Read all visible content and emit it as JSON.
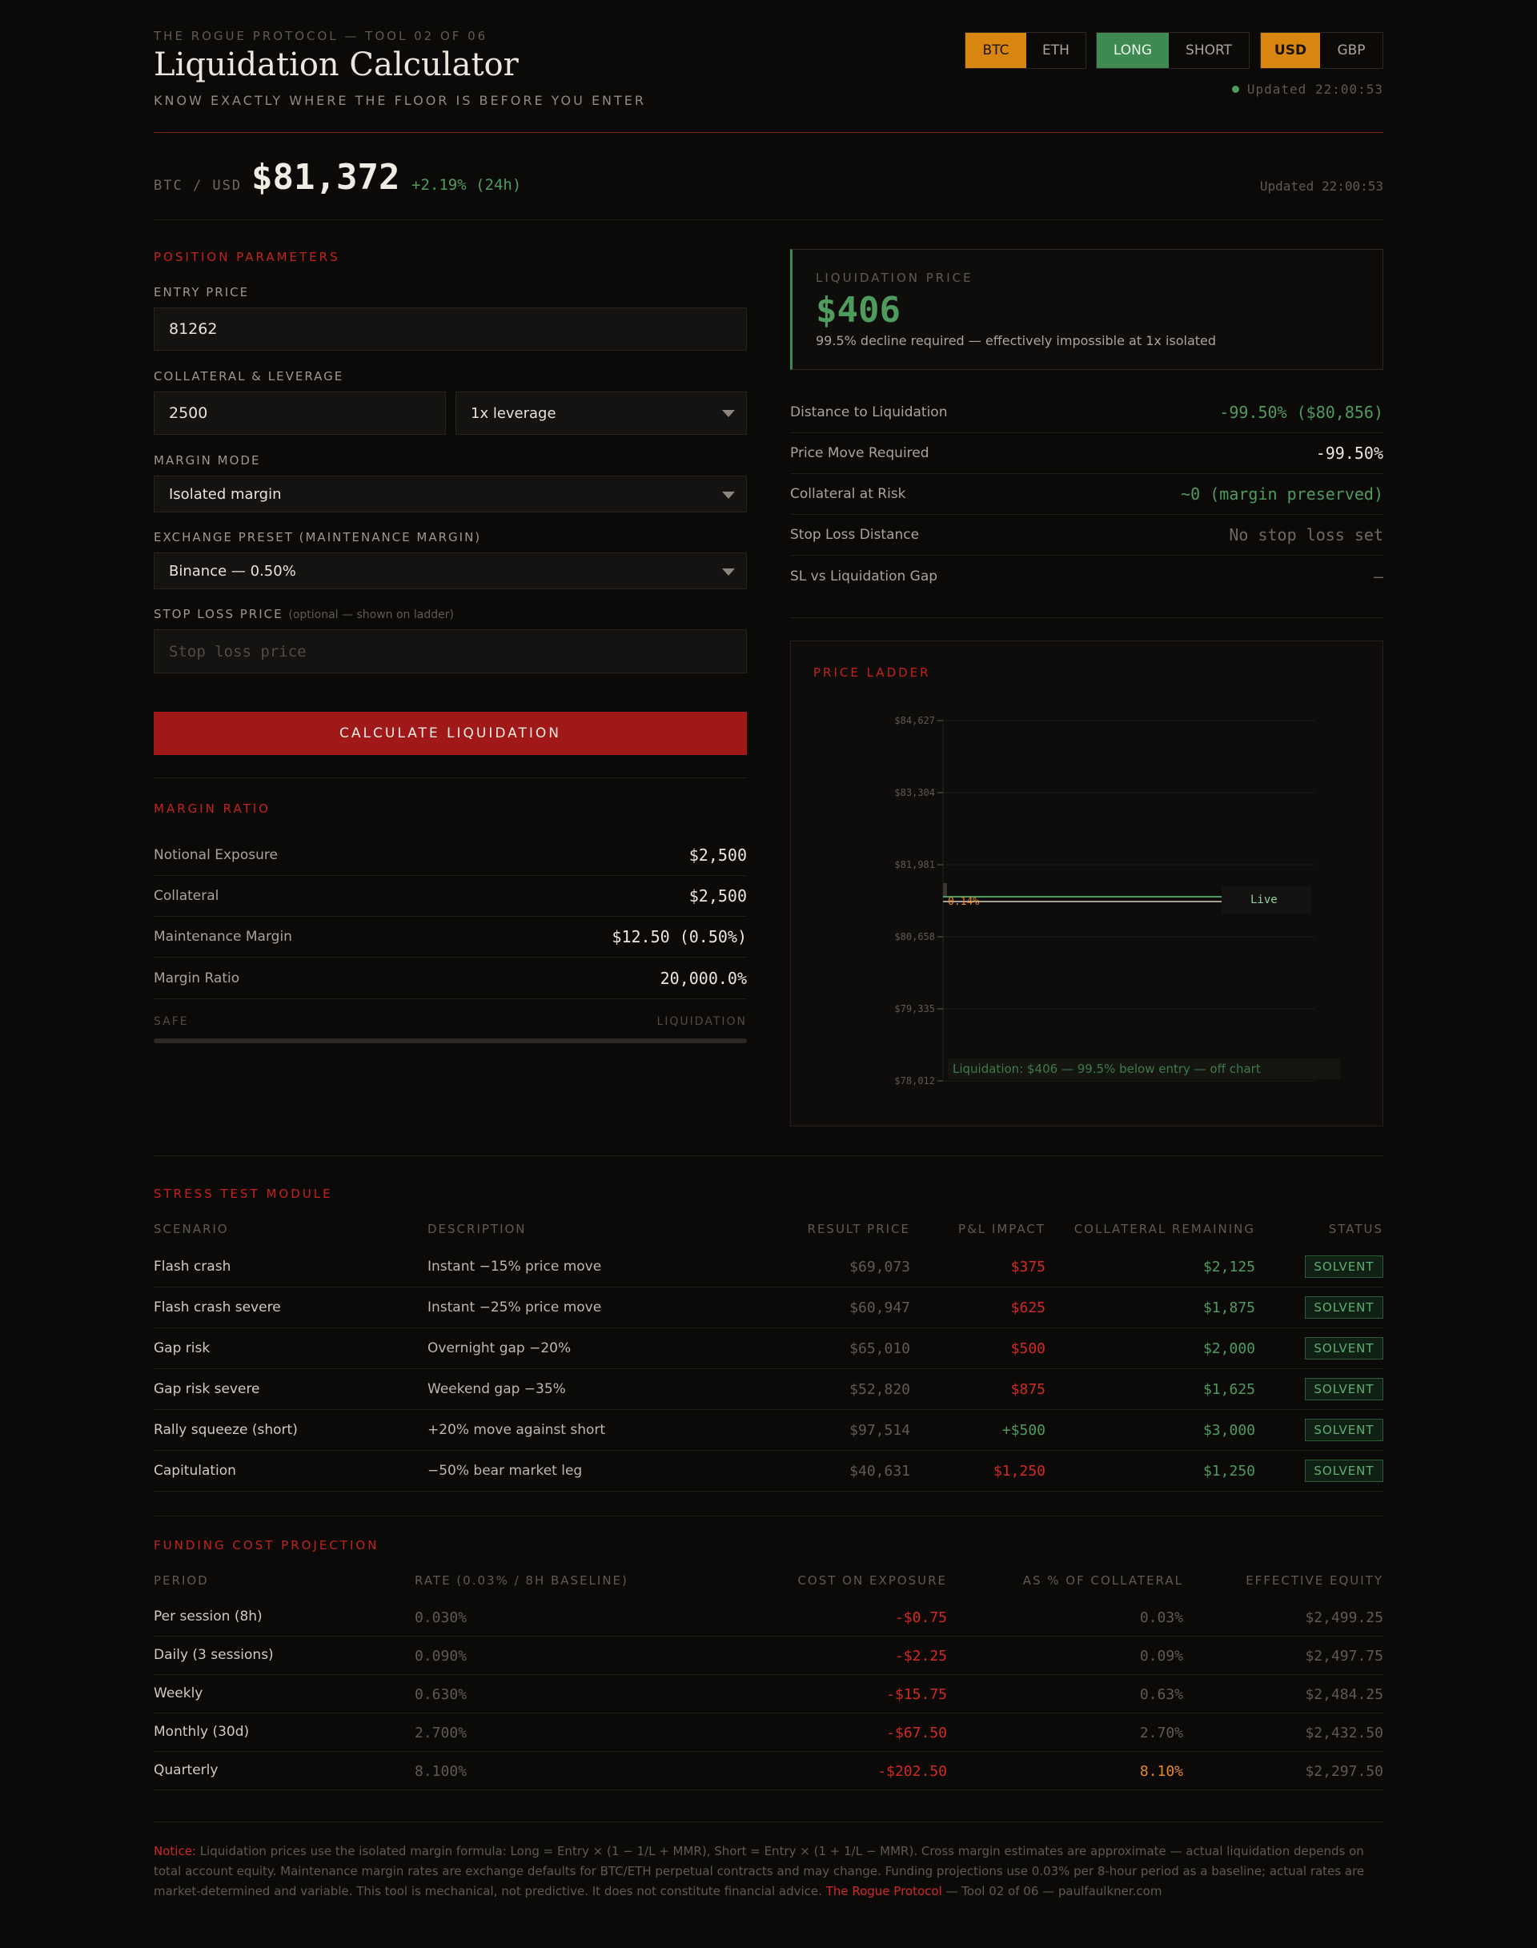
{
  "header": {
    "kicker": "THE ROGUE PROTOCOL — TOOL 02 OF 06",
    "title": "Liquidation Calculator",
    "subtitle": "KNOW EXACTLY WHERE THE FLOOR IS BEFORE YOU ENTER",
    "asset_toggle": [
      "BTC",
      "ETH"
    ],
    "direction_toggle": [
      "LONG",
      "SHORT"
    ],
    "currency_toggle": [
      "USD",
      "GBP"
    ],
    "updated": "Updated 22:00:53"
  },
  "ticker": {
    "pair": "BTC / USD",
    "price": "$81,372",
    "change": "+2.19% (24h)",
    "updated": "Updated 22:00:53"
  },
  "params": {
    "section": "POSITION PARAMETERS",
    "entry_label": "ENTRY PRICE",
    "entry_value": "81262",
    "collateral_label": "COLLATERAL & LEVERAGE",
    "collateral_value": "2500",
    "leverage_value": "1x leverage",
    "margin_mode_label": "MARGIN MODE",
    "margin_mode_value": "Isolated margin",
    "exchange_label": "EXCHANGE PRESET (MAINTENANCE MARGIN)",
    "exchange_value": "Binance — 0.50%",
    "stop_label": "STOP LOSS PRICE",
    "stop_hint": "(optional — shown on ladder)",
    "stop_placeholder": "Stop loss price",
    "calc_button": "CALCULATE LIQUIDATION"
  },
  "margin": {
    "section": "MARGIN RATIO",
    "rows": [
      {
        "k": "Notional Exposure",
        "v": "$2,500"
      },
      {
        "k": "Collateral",
        "v": "$2,500"
      },
      {
        "k": "Maintenance Margin",
        "v": "$12.50 (0.50%)"
      },
      {
        "k": "Margin Ratio",
        "v": "20,000.0%"
      }
    ],
    "scale_left": "SAFE",
    "scale_right": "LIQUIDATION",
    "level": 0
  },
  "liquidation": {
    "label": "LIQUIDATION PRICE",
    "value": "$406",
    "desc": "99.5% decline required — effectively impossible at 1x isolated",
    "rows": [
      {
        "k": "Distance to Liquidation",
        "v": "-99.50% ($80,856)"
      },
      {
        "k": "Price Move Required",
        "v": "-99.50%"
      },
      {
        "k": "Collateral at Risk",
        "v": "~0 (margin preserved)"
      },
      {
        "k": "Stop Loss Distance",
        "v": "No stop loss set"
      },
      {
        "k": "SL vs Liquidation Gap",
        "v": "—"
      }
    ]
  },
  "ladder": {
    "label": "PRICE LADDER",
    "ticks": [
      "$84,627",
      "$83,304",
      "$81,981",
      "$80,658",
      "$79,335",
      "$78,012"
    ],
    "entry_tag": "0.14%",
    "live_tag": "Live",
    "liq_note": "Liquidation: $406 — 99.5% below entry — off chart",
    "colors": {
      "entry": "#e8862a",
      "live": "#4f9a5d"
    }
  },
  "stress": {
    "section": "STRESS TEST MODULE",
    "headers": [
      "SCENARIO",
      "DESCRIPTION",
      "RESULT PRICE",
      "P&L IMPACT",
      "COLLATERAL REMAINING",
      "STATUS"
    ],
    "rows": [
      {
        "scenario": "Flash crash",
        "desc": "Instant −15% price move",
        "price": "$69,073",
        "pnl": "$375",
        "remaining": "$2,125",
        "status": "SOLVENT"
      },
      {
        "scenario": "Flash crash severe",
        "desc": "Instant −25% price move",
        "price": "$60,947",
        "pnl": "$625",
        "remaining": "$1,875",
        "status": "SOLVENT"
      },
      {
        "scenario": "Gap risk",
        "desc": "Overnight gap −20%",
        "price": "$65,010",
        "pnl": "$500",
        "remaining": "$2,000",
        "status": "SOLVENT"
      },
      {
        "scenario": "Gap risk severe",
        "desc": "Weekend gap −35%",
        "price": "$52,820",
        "pnl": "$875",
        "remaining": "$1,625",
        "status": "SOLVENT"
      },
      {
        "scenario": "Rally squeeze (short)",
        "desc": "+20% move against short",
        "price": "$97,514",
        "pnl": "+$500",
        "remaining": "$3,000",
        "status": "SOLVENT"
      },
      {
        "scenario": "Capitulation",
        "desc": "−50% bear market leg",
        "price": "$40,631",
        "pnl": "$1,250",
        "remaining": "$1,250",
        "status": "SOLVENT"
      }
    ]
  },
  "funding": {
    "section": "FUNDING COST PROJECTION",
    "headers": [
      "PERIOD",
      "RATE (0.03% / 8H BASELINE)",
      "COST ON EXPOSURE",
      "AS % OF COLLATERAL",
      "EFFECTIVE EQUITY"
    ],
    "rows": [
      {
        "period": "Per session (8h)",
        "rate": "0.030%",
        "cost": "-$0.75",
        "pct": "0.03%",
        "equity": "$2,499.25"
      },
      {
        "period": "Daily (3 sessions)",
        "rate": "0.090%",
        "cost": "-$2.25",
        "pct": "0.09%",
        "equity": "$2,497.75"
      },
      {
        "period": "Weekly",
        "rate": "0.630%",
        "cost": "-$15.75",
        "pct": "0.63%",
        "equity": "$2,484.25"
      },
      {
        "period": "Monthly (30d)",
        "rate": "2.700%",
        "cost": "-$67.50",
        "pct": "2.70%",
        "equity": "$2,432.50"
      },
      {
        "period": "Quarterly",
        "rate": "8.100%",
        "cost": "-$202.50",
        "pct": "8.10%",
        "equity": "$2,297.50"
      }
    ]
  },
  "notice": {
    "lead": "Notice:",
    "text": " Liquidation prices use the isolated margin formula: Long = Entry × (1 − 1/L + MMR), Short = Entry × (1 + 1/L − MMR). Cross margin estimates are approximate — actual liquidation depends on total account equity. Maintenance margin rates are exchange defaults for BTC/ETH perpetual contracts and may change. Funding projections use 0.03% per 8-hour period as a baseline; actual rates are market-determined and variable. This tool is mechanical, not predictive. It does not constitute financial advice. ",
    "brand": "The Rogue Protocol",
    "tail": " — Tool 02 of 06 — paulfaulkner.com"
  }
}
